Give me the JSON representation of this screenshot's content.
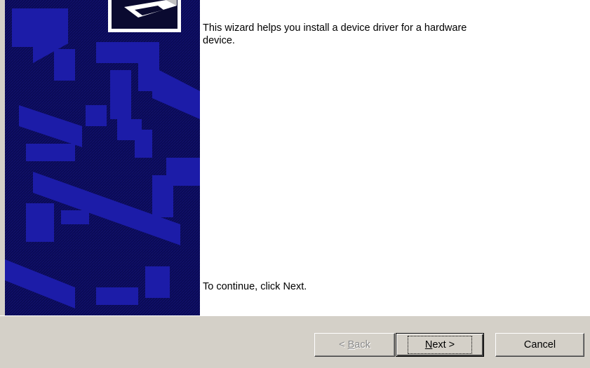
{
  "wizard": {
    "intro_text": "This wizard helps you install a device driver for a hardware device.",
    "continue_text": "To continue, click Next."
  },
  "buttons": {
    "back_prefix": "< ",
    "back_mnemonic": "B",
    "back_rest": "ack",
    "next_mnemonic": "N",
    "next_rest": "ext >",
    "cancel_label": "Cancel"
  },
  "colors": {
    "banner_background": "#0a0a55",
    "banner_pattern": "#1c1ca8",
    "dialog_gray": "#d4d0c8"
  },
  "icons": {
    "banner_graphic": "hardware-wizard-graphic-icon",
    "logo": "device-box-icon"
  }
}
